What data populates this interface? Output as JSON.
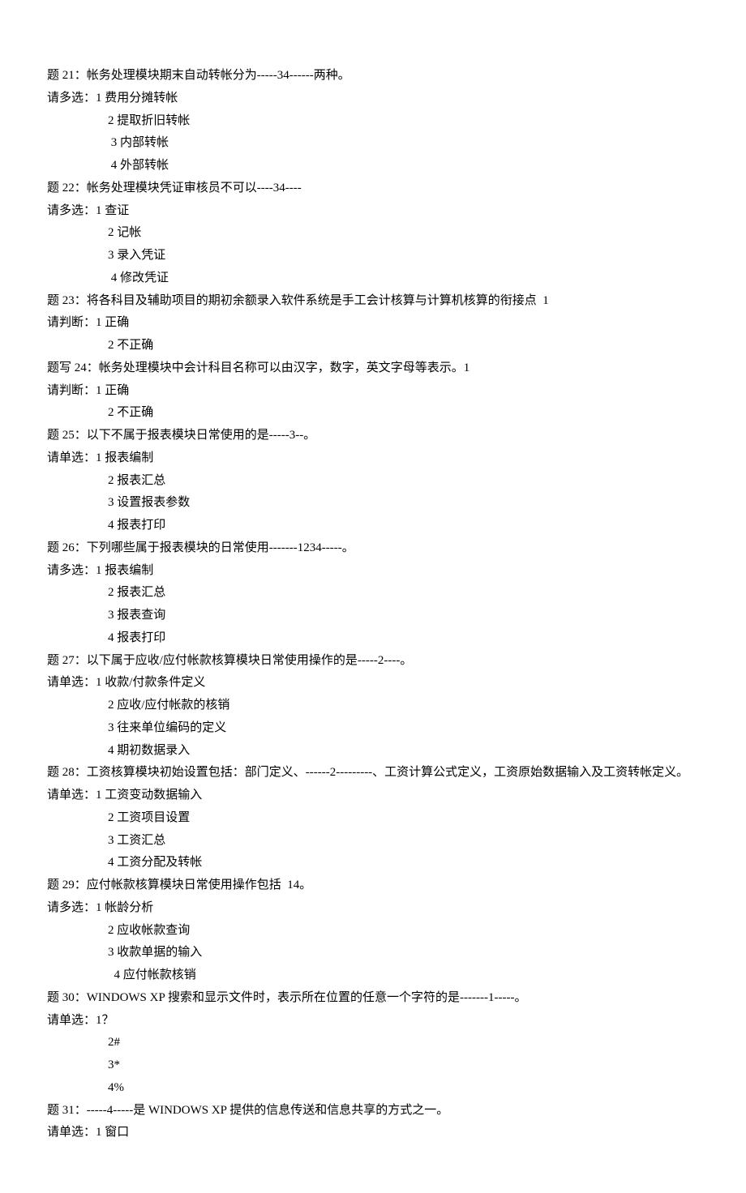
{
  "questions": [
    {
      "title": "题 21：帐务处理模块期末自动转帐分为-----34------两种。",
      "prompt": "请多选：",
      "options": [
        "1 费用分摊转帐",
        "2 提取折旧转帐",
        " 3 内部转帐",
        " 4 外部转帐"
      ]
    },
    {
      "title": "题 22：帐务处理模块凭证审核员不可以----34----",
      "prompt": "请多选：",
      "options": [
        "1 查证",
        "2 记帐",
        "3 录入凭证",
        " 4 修改凭证"
      ]
    },
    {
      "title": "题 23：将各科目及辅助项目的期初余额录入软件系统是手工会计核算与计算机核算的衔接点  1",
      "prompt": "请判断：",
      "options": [
        "1 正确",
        "2 不正确"
      ]
    },
    {
      "title": "题写 24：帐务处理模块中会计科目名称可以由汉字，数字，英文字母等表示。1",
      "prompt": "请判断：",
      "options": [
        "1 正确",
        "2 不正确"
      ]
    },
    {
      "title": "题 25：以下不属于报表模块日常使用的是-----3--。",
      "prompt": "请单选：",
      "options": [
        "1 报表编制",
        "2 报表汇总",
        "3 设置报表参数",
        "4 报表打印"
      ]
    },
    {
      "title": "题 26：下列哪些属于报表模块的日常使用-------1234-----。",
      "prompt": "请多选：",
      "options": [
        "1 报表编制",
        "2 报表汇总",
        "3 报表查询",
        "4 报表打印"
      ]
    },
    {
      "title": "题 27：以下属于应收/应付帐款核算模块日常使用操作的是-----2----。",
      "prompt": "请单选：",
      "options": [
        "1 收款/付款条件定义",
        "2 应收/应付帐款的核销",
        "3 往来单位编码的定义",
        "4 期初数据录入"
      ]
    },
    {
      "title": "题 28：工资核算模块初始设置包括：部门定义、------2---------、工资计算公式定义，工资原始数据输入及工资转帐定义。",
      "prompt": "请单选：",
      "options": [
        "1 工资变动数据输入",
        "2 工资项目设置",
        "3 工资汇总",
        "4 工资分配及转帐"
      ]
    },
    {
      "title": "题 29：应付帐款核算模块日常使用操作包括  14。",
      "prompt": "请多选：",
      "options": [
        "1 帐龄分析",
        "2 应收帐款查询",
        "3 收款单据的输入",
        "  4 应付帐款核销"
      ]
    },
    {
      "title": "题 30：WINDOWS XP 搜索和显示文件时，表示所在位置的任意一个字符的是-------1-----。",
      "prompt": "请单选：",
      "options": [
        "1？",
        "2#",
        "3*",
        "4%"
      ]
    },
    {
      "title": "题 31：-----4-----是 WINDOWS XP 提供的信息传送和信息共享的方式之一。",
      "prompt": "请单选：",
      "options": [
        "1 窗口"
      ]
    }
  ]
}
